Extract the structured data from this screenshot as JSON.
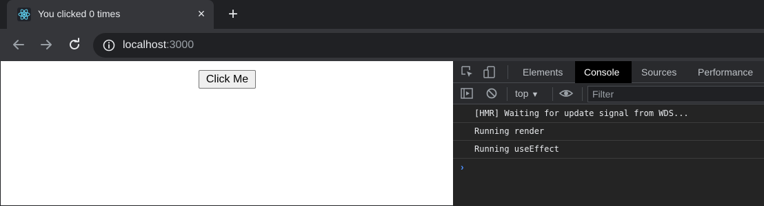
{
  "tab": {
    "title": "You clicked 0 times",
    "favicon": "react-logo-icon",
    "close": "×"
  },
  "newtab": "+",
  "omnibox": {
    "host": "localhost",
    "port": ":3000"
  },
  "page": {
    "button_label": "Click Me"
  },
  "devtools": {
    "tabs": [
      "Elements",
      "Console",
      "Sources",
      "Performance"
    ],
    "active_tab": "Console",
    "context": "top",
    "filter_placeholder": "Filter",
    "logs": [
      "[HMR] Waiting for update signal from WDS...",
      "Running render",
      "Running useEffect"
    ],
    "prompt": "›"
  },
  "colors": {
    "accent": "#4c8df6",
    "page_bg": "#ffffff",
    "chrome_bg": "#35363a"
  }
}
